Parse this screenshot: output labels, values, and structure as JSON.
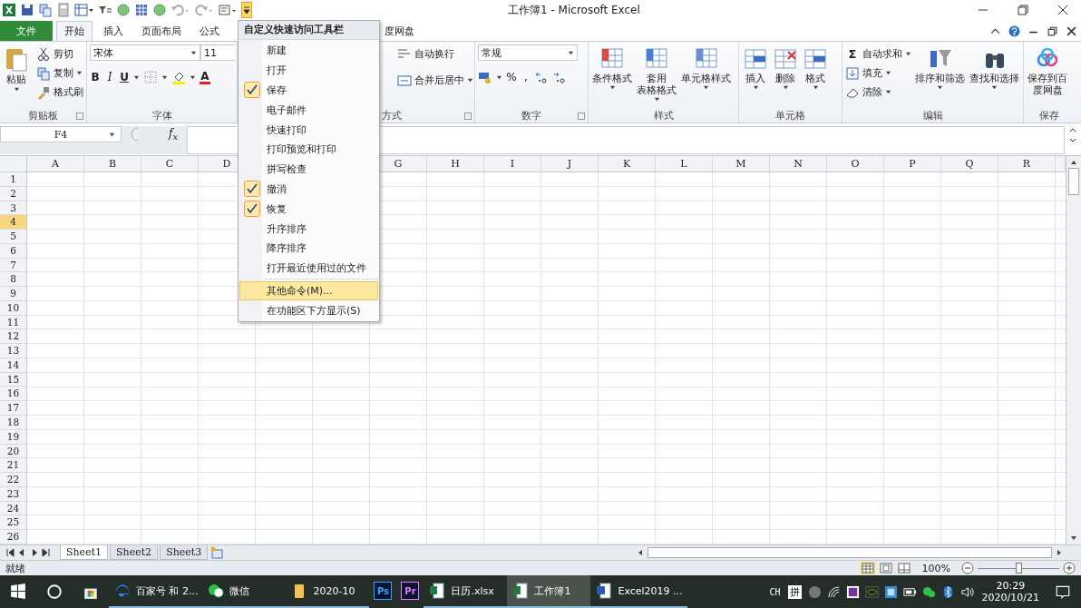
{
  "window": {
    "title": "工作簿1 - Microsoft Excel"
  },
  "tabs": [
    {
      "label": "文件",
      "kind": "file",
      "selected": false
    },
    {
      "label": "开始",
      "kind": "tab",
      "selected": true
    },
    {
      "label": "插入",
      "kind": "tab",
      "selected": false
    },
    {
      "label": "页面布局",
      "kind": "tab",
      "selected": false
    },
    {
      "label": "公式",
      "kind": "tab",
      "selected": false
    },
    {
      "label": "度网盘",
      "kind": "clipped",
      "selected": false
    }
  ],
  "ribbon": {
    "clipboard": {
      "label": "剪贴板",
      "paste": "粘贴",
      "cut": "剪切",
      "copy": "复制",
      "format_painter": "格式刷"
    },
    "font": {
      "label": "字体",
      "font_name": "宋体",
      "font_size": "11",
      "bold": "B",
      "italic": "I",
      "underline": "U",
      "font_color": "A"
    },
    "alignment": {
      "label": "方式",
      "wrap_text": "自动换行",
      "merge_center": "合并后居中"
    },
    "number": {
      "label": "数字",
      "format": "常规",
      "percent": "%",
      "comma": ","
    },
    "styles": {
      "label": "样式",
      "buttons": [
        [
          "条件格式"
        ],
        [
          "套用",
          "表格格式"
        ],
        [
          "单元格样式"
        ]
      ]
    },
    "cells": {
      "label": "单元格",
      "buttons": [
        "插入",
        "删除",
        "格式"
      ]
    },
    "editing": {
      "label": "编辑",
      "sum_symbol": "Σ",
      "small_buttons": [
        "自动求和",
        "填充",
        "清除"
      ],
      "buttons": [
        "排序和筛选",
        "查找和选择"
      ]
    },
    "save": {
      "label": "保存",
      "button": [
        "保存到百",
        "度网盘"
      ]
    }
  },
  "formula_bar": {
    "name_box": "F4",
    "function_label": "f$_{x}$"
  },
  "sheet": {
    "columns": [
      "A",
      "B",
      "C",
      "D",
      "G",
      "H",
      "I",
      "J",
      "K",
      "L",
      "M",
      "N",
      "O",
      "P",
      "Q",
      "R"
    ],
    "rows": [
      {
        "label": "1",
        "selected": false
      },
      {
        "label": "2",
        "selected": false
      },
      {
        "label": "3",
        "selected": false
      },
      {
        "label": "4",
        "selected": true
      },
      {
        "label": "5",
        "selected": false
      },
      {
        "label": "6",
        "selected": false
      },
      {
        "label": "7",
        "selected": false
      },
      {
        "label": "8",
        "selected": false
      },
      {
        "label": "9",
        "selected": false
      },
      {
        "label": "10",
        "selected": false
      },
      {
        "label": "11",
        "selected": false
      },
      {
        "label": "12",
        "selected": false
      },
      {
        "label": "13",
        "selected": false
      },
      {
        "label": "14",
        "selected": false
      },
      {
        "label": "15",
        "selected": false
      },
      {
        "label": "16",
        "selected": false
      },
      {
        "label": "17",
        "selected": false
      },
      {
        "label": "18",
        "selected": false
      },
      {
        "label": "19",
        "selected": false
      },
      {
        "label": "20",
        "selected": false
      },
      {
        "label": "21",
        "selected": false
      },
      {
        "label": "22",
        "selected": false
      },
      {
        "label": "23",
        "selected": false
      },
      {
        "label": "24",
        "selected": false
      },
      {
        "label": "25",
        "selected": false
      },
      {
        "label": "26",
        "selected": false
      }
    ]
  },
  "sheet_tabs": [
    {
      "label": "Sheet1",
      "selected": true
    },
    {
      "label": "Sheet2",
      "selected": false
    },
    {
      "label": "Sheet3",
      "selected": false
    }
  ],
  "status_bar": {
    "status": "就绪",
    "zoom": "100%",
    "zoom_slider": {
      "level": 0.5
    }
  },
  "quick_access_menu": {
    "title": "自定义快速访问工具栏",
    "items": [
      {
        "label": "新建",
        "checked": false,
        "selected": false
      },
      {
        "label": "打开",
        "checked": false,
        "selected": false
      },
      {
        "label": "保存",
        "checked": true,
        "selected": false
      },
      {
        "label": "电子邮件",
        "checked": false,
        "selected": false
      },
      {
        "label": "快速打印",
        "checked": false,
        "selected": false
      },
      {
        "label": "打印预览和打印",
        "checked": false,
        "selected": false
      },
      {
        "label": "拼写检查",
        "checked": false,
        "selected": false
      },
      {
        "label": "撤消",
        "checked": true,
        "selected": false
      },
      {
        "label": "恢复",
        "checked": true,
        "selected": false
      },
      {
        "label": "升序排序",
        "checked": false,
        "selected": false
      },
      {
        "label": "降序排序",
        "checked": false,
        "selected": false
      },
      {
        "label": "打开最近使用过的文件",
        "checked": false,
        "selected": false
      }
    ],
    "more_items": [
      {
        "label": "其他命令(M)...",
        "selected": true
      },
      {
        "label": "在功能区下方显示(S)",
        "selected": false
      }
    ]
  },
  "taskbar": {
    "apps": [
      {
        "label": "百家号 和 2...",
        "running": true,
        "selected": false
      },
      {
        "label": "微信",
        "running": true,
        "selected": false
      },
      {
        "label": "2020-10",
        "running": true,
        "selected": false
      },
      {
        "badge": "Ps",
        "running": false,
        "selected": false
      },
      {
        "badge": "Pr",
        "running": false,
        "selected": false
      },
      {
        "label": "日历.xlsx",
        "running": true,
        "selected": false
      },
      {
        "label": "工作簿1",
        "running": true,
        "selected": true
      },
      {
        "label": "Excel2019 ...",
        "running": true,
        "selected": false
      }
    ],
    "input_language": "CH",
    "input_method": "拼",
    "time": "20:29",
    "date": "2020/10/21"
  }
}
